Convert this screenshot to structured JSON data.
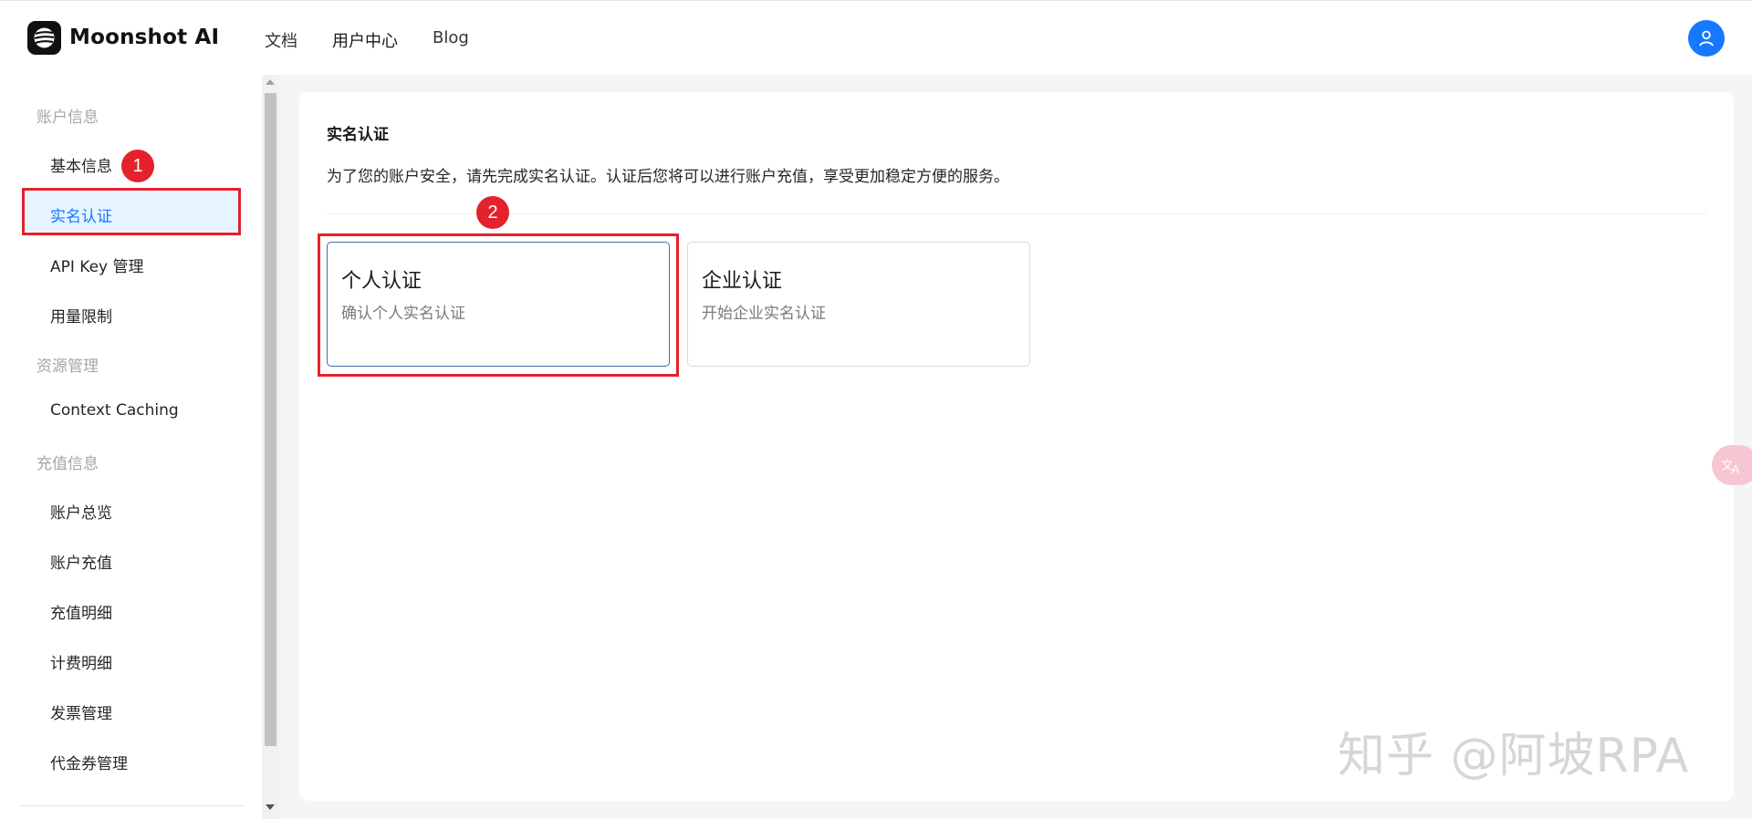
{
  "header": {
    "brand": "Moonshot AI",
    "nav": [
      "文档",
      "用户中心",
      "Blog"
    ],
    "avatar_icon": "user-icon",
    "accent": "#1677ff"
  },
  "sidebar": {
    "groups": [
      {
        "label": "账户信息",
        "items": [
          "基本信息",
          "实名认证",
          "API Key 管理",
          "用量限制"
        ]
      },
      {
        "label": "资源管理",
        "items": [
          "Context Caching"
        ]
      },
      {
        "label": "充值信息",
        "items": [
          "账户总览",
          "账户充值",
          "充值明细",
          "计费明细",
          "发票管理",
          "代金券管理"
        ]
      }
    ],
    "active_item": "实名认证"
  },
  "main": {
    "title": "实名认证",
    "description": "为了您的账户安全，请先完成实名认证。认证后您将可以进行账户充值，享受更加稳定方便的服务。",
    "options": [
      {
        "title": "个人认证",
        "subtitle": "确认个人实名认证"
      },
      {
        "title": "企业认证",
        "subtitle": "开始企业实名认证"
      }
    ]
  },
  "annotations": {
    "badge_1": "1",
    "badge_2": "2",
    "color": "#e3222b"
  },
  "watermark": "知乎 @阿坡RPA"
}
